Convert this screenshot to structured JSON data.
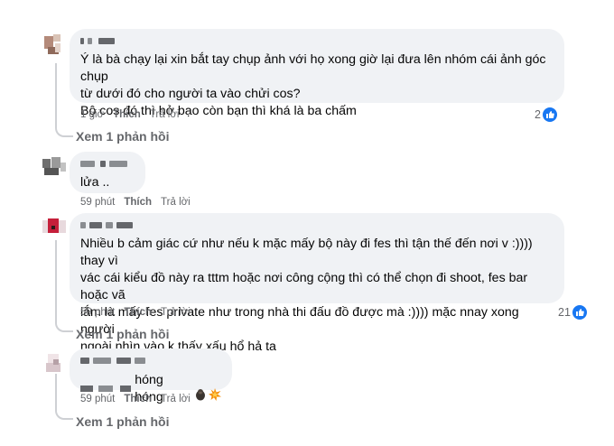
{
  "comments": [
    {
      "text": "Ý là bà chạy lại xin bắt tay chụp ảnh với họ xong giờ lại đưa lên nhóm cái ảnh góc chụp\ntừ dưới đó cho người ta vào chửi cos?\nBộ cos đó thì hở bạo còn bạn thì khá là ba chấm",
      "time": "1 giờ",
      "like_label": "Thích",
      "reply_label": "Trả lời",
      "reaction_count": "2",
      "view_replies": "Xem 1 phản hồi"
    },
    {
      "text": "lửa ..",
      "time": "59 phút",
      "like_label": "Thích",
      "reply_label": "Trả lời"
    },
    {
      "text": "Nhiều b cảm giác cứ như nếu k mặc mấy bộ này đi fes thì tận thế đến nơi v :)))) thay vì\nvác cái kiểu đồ này ra tttm hoặc nơi công cộng thì có thể chọn đi shoot, fes bar hoặc vã\nlắm là mấy fes private như trong nhà thi đấu đồ được mà :)))) mặc nnay xong người\nngoài nhìn vào k thấy xấu hổ hả ta",
      "time": "59 phút",
      "like_label": "Thích",
      "reply_label": "Trả lời",
      "reaction_count": "21",
      "view_replies": "Xem 1 phản hồi"
    },
    {
      "text": "hóng hóng",
      "emoji_names": [
        "gorilla-emoji",
        "collision-emoji"
      ],
      "time": "59 phút",
      "like_label": "Thích",
      "reply_label": "Trả lời",
      "view_replies": "Xem 1 phản hồi"
    }
  ],
  "colors": {
    "bubble": "#f0f2f5",
    "secondary_text": "#65676b",
    "like_blue": "#1877f2",
    "thread_line": "#ced0d4"
  }
}
